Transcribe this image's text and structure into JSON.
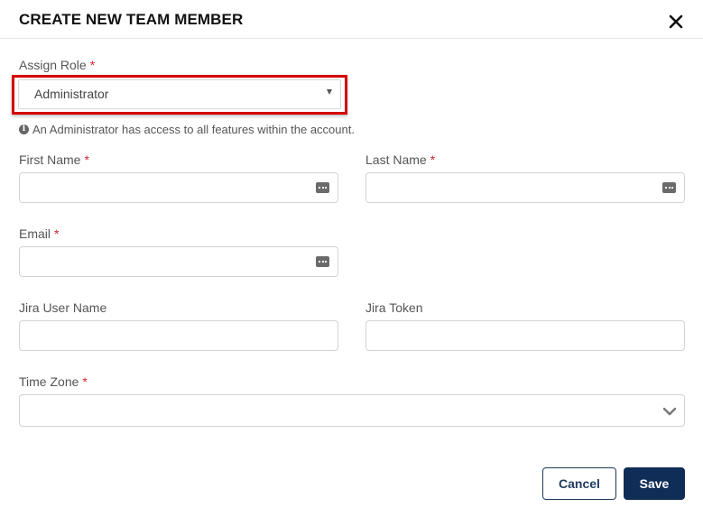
{
  "dialog": {
    "title": "CREATE NEW TEAM MEMBER"
  },
  "role": {
    "label": "Assign Role",
    "required_mark": "*",
    "selected": "Administrator",
    "help_text": "An Administrator has access to all features within the account."
  },
  "fields": {
    "first_name": {
      "label": "First Name",
      "required_mark": "*",
      "value": ""
    },
    "last_name": {
      "label": "Last Name",
      "required_mark": "*",
      "value": ""
    },
    "email": {
      "label": "Email",
      "required_mark": "*",
      "value": ""
    },
    "jira_user_name": {
      "label": "Jira User Name",
      "value": ""
    },
    "jira_token": {
      "label": "Jira Token",
      "value": ""
    },
    "time_zone": {
      "label": "Time Zone",
      "required_mark": "*",
      "selected": ""
    }
  },
  "actions": {
    "cancel_label": "Cancel",
    "save_label": "Save"
  },
  "colors": {
    "highlight": "#d40000",
    "required": "#d9232d",
    "primary": "#0f2d57"
  }
}
